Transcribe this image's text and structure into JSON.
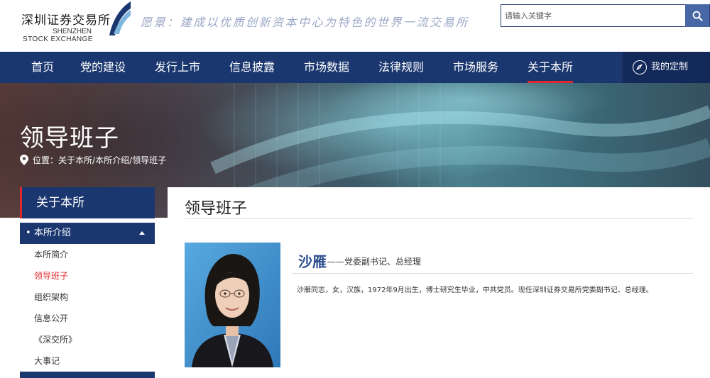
{
  "header": {
    "logo_cn": "深圳证券交易所",
    "logo_en_line1": "SHENZHEN",
    "logo_en_line2": "STOCK EXCHANGE",
    "slogan": "愿景：建成以优质创新资本中心为特色的世界一流交易所",
    "search_placeholder": "请输入关键字",
    "search_icon": "search-icon"
  },
  "nav": {
    "items": [
      {
        "label": "首页"
      },
      {
        "label": "党的建设"
      },
      {
        "label": "发行上市"
      },
      {
        "label": "信息披露"
      },
      {
        "label": "市场数据"
      },
      {
        "label": "法律规则"
      },
      {
        "label": "市场服务"
      },
      {
        "label": "关于本所"
      }
    ],
    "active_index": 7,
    "custom_label": "我的定制",
    "custom_icon": "compass-icon"
  },
  "banner": {
    "title": "领导班子",
    "location_prefix": "位置：",
    "breadcrumb": [
      "关于本所",
      "本所介绍",
      "领导班子"
    ],
    "breadcrumb_sep": "/"
  },
  "sidebar": {
    "header": "关于本所",
    "group_label": "本所介绍",
    "group_bullet": "•",
    "subitems": [
      {
        "label": "本所简介"
      },
      {
        "label": "领导班子"
      },
      {
        "label": "组织架构"
      },
      {
        "label": "信息公开"
      },
      {
        "label": "《深交所》"
      },
      {
        "label": "大事记"
      }
    ],
    "active_index": 1
  },
  "content": {
    "title": "领导班子",
    "person": {
      "name": "沙雁",
      "role": "——党委副书记、总经理",
      "bio": "沙雁同志，女，汉族，1972年9月出生，博士研究生毕业，中共党员。现任深圳证券交易所党委副书记、总经理。"
    }
  },
  "colors": {
    "nav_bg": "#1b3770",
    "accent_red": "#e1272b",
    "name_blue": "#2d4f8e",
    "search_btn": "#4767a5"
  }
}
